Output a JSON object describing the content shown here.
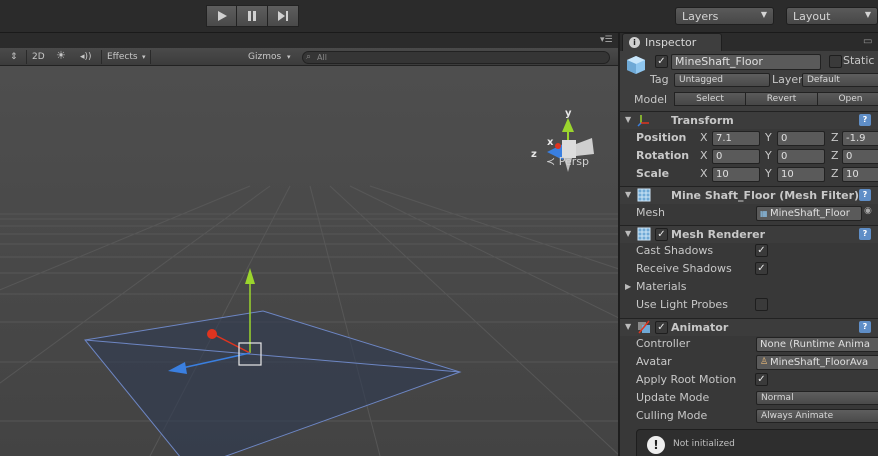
{
  "toolbar": {
    "play_icon": "play-icon",
    "pause_icon": "pause-icon",
    "step_icon": "step-icon",
    "layers_label": "Layers",
    "layout_label": "Layout"
  },
  "scene": {
    "toggle_2d": "2D",
    "effects_label": "Effects",
    "gizmos_label": "Gizmos",
    "search_placeholder": "All",
    "persp_label": "Persp",
    "axis_x": "x",
    "axis_y": "y",
    "axis_z": "z"
  },
  "inspector": {
    "tab_label": "Inspector",
    "object_name": "MineShaft_Floor",
    "static_label": "Static",
    "tag_label": "Tag",
    "tag_value": "Untagged",
    "layer_label": "Layer",
    "layer_value": "Default",
    "model_label": "Model",
    "select_label": "Select",
    "revert_label": "Revert",
    "open_label": "Open",
    "transform": {
      "title": "Transform",
      "position_label": "Position",
      "rotation_label": "Rotation",
      "scale_label": "Scale",
      "x_label": "X",
      "y_label": "Y",
      "z_label": "Z",
      "position": {
        "x": "7.1",
        "y": "0",
        "z": "-1.9"
      },
      "rotation": {
        "x": "0",
        "y": "0",
        "z": "0"
      },
      "scale": {
        "x": "10",
        "y": "10",
        "z": "10"
      }
    },
    "mesh_filter": {
      "title": "Mine Shaft_Floor (Mesh Filter)",
      "mesh_label": "Mesh",
      "mesh_value": "MineShaft_Floor"
    },
    "mesh_renderer": {
      "title": "Mesh Renderer",
      "cast_shadows_label": "Cast Shadows",
      "receive_shadows_label": "Receive Shadows",
      "materials_label": "Materials",
      "use_light_probes_label": "Use Light Probes"
    },
    "animator": {
      "title": "Animator",
      "controller_label": "Controller",
      "controller_value": "None (Runtime Anima",
      "avatar_label": "Avatar",
      "avatar_value": "MineShaft_FloorAva",
      "apply_root_motion_label": "Apply Root Motion",
      "update_mode_label": "Update Mode",
      "update_mode_value": "Normal",
      "culling_mode_label": "Culling Mode",
      "culling_mode_value": "Always Animate",
      "status_message": "Not initialized"
    }
  },
  "colors": {
    "accent_blue": "#5f8ec7",
    "axis_x": "#e0341f",
    "axis_y": "#9bd52d",
    "axis_z": "#3a7fe0"
  }
}
